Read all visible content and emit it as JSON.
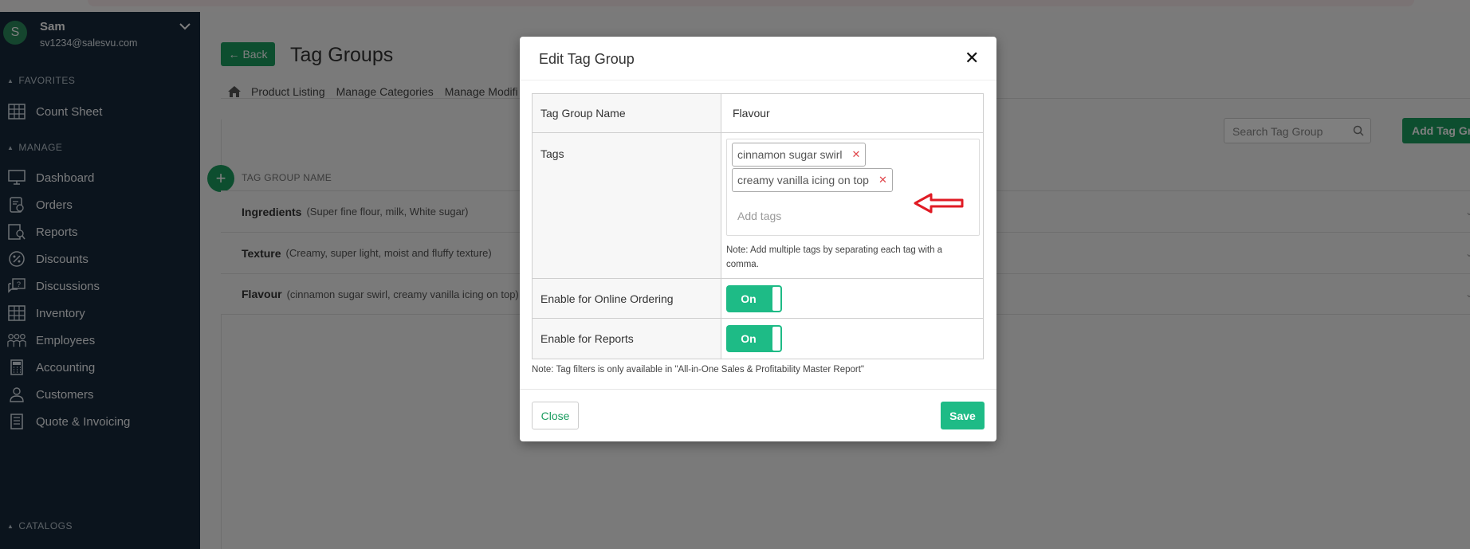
{
  "user": {
    "initial": "S",
    "name": "Sam",
    "email": "sv1234@salesvu.com"
  },
  "sidebar": {
    "sections": {
      "favorites": "FAVORITES",
      "manage": "MANAGE",
      "catalogs": "CATALOGS"
    },
    "items": [
      {
        "label": "Count Sheet",
        "icon": "grid-calculator-icon"
      },
      {
        "label": "Dashboard",
        "icon": "monitor-icon"
      },
      {
        "label": "Orders",
        "icon": "orders-icon"
      },
      {
        "label": "Reports",
        "icon": "reports-icon"
      },
      {
        "label": "Discounts",
        "icon": "percent-icon"
      },
      {
        "label": "Discussions",
        "icon": "chat-icon"
      },
      {
        "label": "Inventory",
        "icon": "inventory-icon"
      },
      {
        "label": "Employees",
        "icon": "employees-icon"
      },
      {
        "label": "Accounting",
        "icon": "calculator-icon"
      },
      {
        "label": "Customers",
        "icon": "customer-icon"
      },
      {
        "label": "Quote & Invoicing",
        "icon": "invoice-icon"
      }
    ]
  },
  "header": {
    "back_label": "Back",
    "title": "Tag Groups",
    "tabs": [
      "Product Listing",
      "Manage Categories",
      "Manage Modifi"
    ],
    "search_placeholder": "Search Tag Group",
    "add_label": "Add Tag Gr"
  },
  "table": {
    "column_header": "TAG GROUP NAME",
    "rows": [
      {
        "name": "Ingredients",
        "desc": "(Super fine flour, milk, White sugar)"
      },
      {
        "name": "Texture",
        "desc": "(Creamy, super light, moist and fluffy texture)"
      },
      {
        "name": "Flavour",
        "desc": "(cinnamon sugar swirl, creamy vanilla icing on top)"
      }
    ]
  },
  "modal": {
    "title": "Edit Tag Group",
    "name_label": "Tag Group Name",
    "name_value": "Flavour",
    "tags_label": "Tags",
    "tags": [
      "cinnamon sugar swirl",
      "creamy vanilla icing on top"
    ],
    "add_tags_placeholder": "Add tags",
    "tags_note": "Note: Add multiple tags by separating each tag with a comma.",
    "online_label": "Enable for Online Ordering",
    "online_state": "On",
    "reports_label": "Enable for Reports",
    "reports_state": "On",
    "footer_note": "Note: Tag filters is only available in \"All-in-One Sales & Profitability Master Report\"",
    "close_label": "Close",
    "save_label": "Save"
  },
  "colors": {
    "primary": "#1a9c5f",
    "toggle": "#1ebb86",
    "sidebar": "#17293a",
    "remove": "#e0474c",
    "annotation": "#e01b24"
  }
}
